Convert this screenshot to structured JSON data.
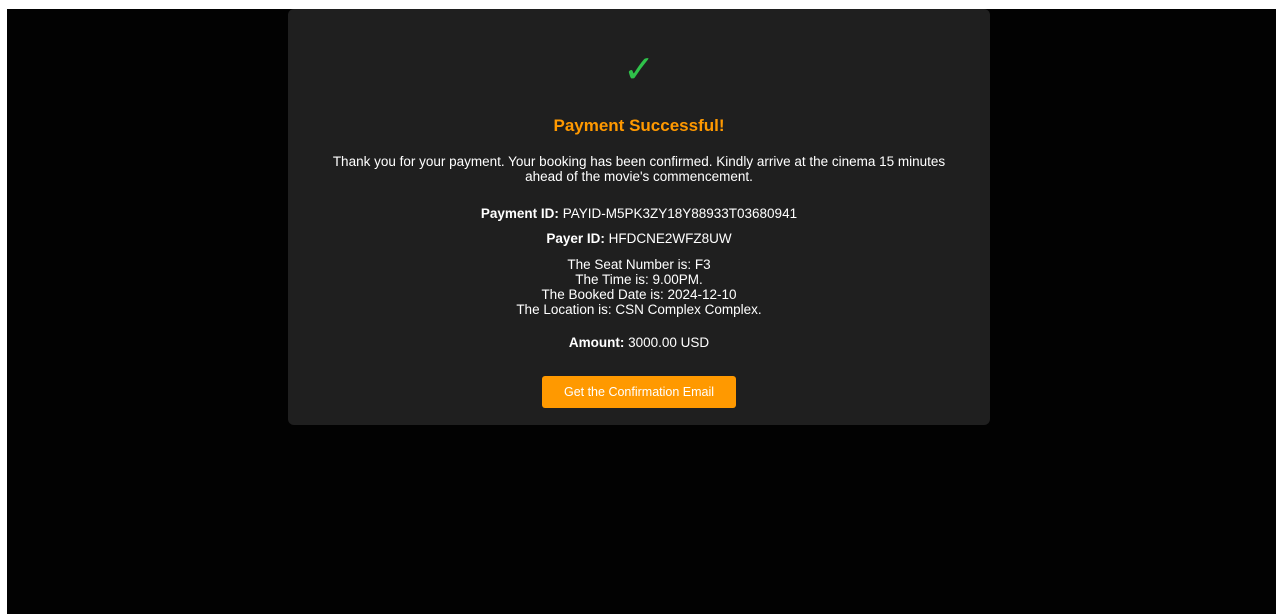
{
  "status": {
    "icon": "check-mark-icon",
    "icon_glyph": "✓",
    "title": "Payment Successful!",
    "message": "Thank you for your payment. Your booking has been confirmed. Kindly arrive at the cinema 15 minutes ahead of the movie's commencement."
  },
  "payment": {
    "payment_id_label": "Payment ID:",
    "payment_id_value": "PAYID-M5PK3ZY18Y88933T03680941",
    "payer_id_label": "Payer ID:",
    "payer_id_value": "HFDCNE2WFZ8UW",
    "amount_label": "Amount:",
    "amount_value": "3000.00 USD"
  },
  "booking": {
    "seat": "The Seat Number is: F3",
    "time": "The Time is: 9.00PM.",
    "date": "The Booked Date is: 2024-12-10",
    "location": "The Location is: CSN Complex Complex."
  },
  "actions": {
    "confirmation_email_label": "Get the Confirmation Email"
  },
  "colors": {
    "background": "#020202",
    "card": "#1f1f1f",
    "accent": "#ff9900",
    "success": "#2fc14a",
    "text": "#ffffff"
  }
}
